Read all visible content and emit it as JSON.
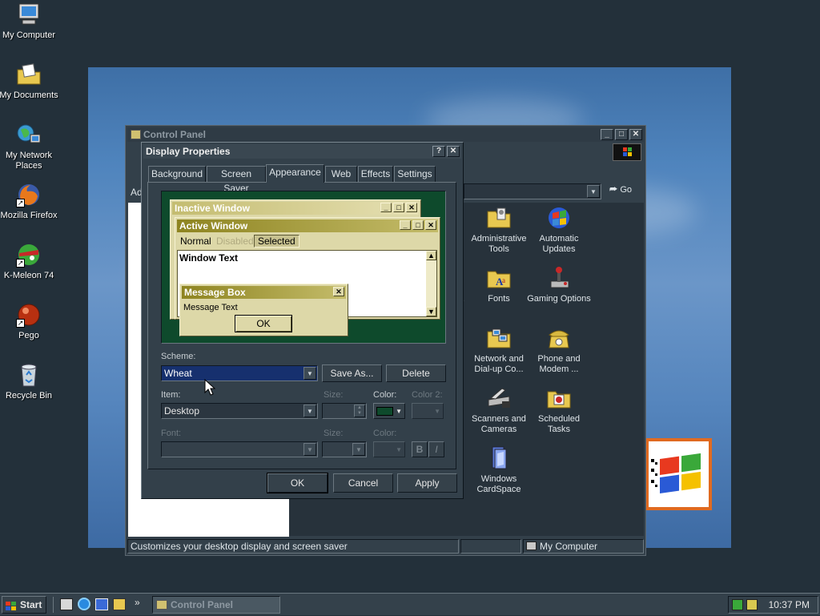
{
  "desktop": {
    "icons": [
      {
        "label": "My Computer",
        "icon": "computer-icon"
      },
      {
        "label": "My Documents",
        "icon": "folder-documents-icon"
      },
      {
        "label": "My Network Places",
        "icon": "network-icon"
      },
      {
        "label": "Mozilla Firefox",
        "icon": "firefox-icon"
      },
      {
        "label": "K-Meleon 74",
        "icon": "kmeleon-icon"
      },
      {
        "label": "Pego",
        "icon": "pego-icon"
      },
      {
        "label": "Recycle Bin",
        "icon": "recycle-bin-icon"
      }
    ]
  },
  "control_panel": {
    "title": "Control Panel",
    "address_label": "Ad",
    "go_label": "Go",
    "items": [
      {
        "label": "Administrative Tools",
        "icon": "administrative-tools-icon"
      },
      {
        "label": "Automatic Updates",
        "icon": "automatic-updates-icon"
      },
      {
        "label": "Fonts",
        "icon": "fonts-icon"
      },
      {
        "label": "Gaming Options",
        "icon": "gaming-options-icon"
      },
      {
        "label": "Network and Dial-up Co...",
        "icon": "network-dialup-icon"
      },
      {
        "label": "Phone and Modem ...",
        "icon": "phone-modem-icon"
      },
      {
        "label": "Scanners and Cameras",
        "icon": "scanners-cameras-icon"
      },
      {
        "label": "Scheduled Tasks",
        "icon": "scheduled-tasks-icon"
      },
      {
        "label": "Windows CardSpace",
        "icon": "cardspace-icon"
      }
    ],
    "status_text": "Customizes your desktop display and screen saver",
    "status_location": "My Computer"
  },
  "dialog": {
    "title": "Display Properties",
    "tabs": [
      "Background",
      "Screen Saver",
      "Appearance",
      "Web",
      "Effects",
      "Settings"
    ],
    "selected_tab": "Appearance",
    "preview": {
      "inactive_title": "Inactive Window",
      "active_title": "Active Window",
      "menu_normal": "Normal",
      "menu_disabled": "Disabled",
      "menu_selected": "Selected",
      "window_text": "Window Text",
      "message_box_title": "Message Box",
      "message_text": "Message Text",
      "ok_label": "OK"
    },
    "scheme_label": "Scheme:",
    "scheme_value": "Wheat",
    "save_as_label": "Save As...",
    "delete_label": "Delete",
    "item_label": "Item:",
    "item_value": "Desktop",
    "size_label": "Size:",
    "color_label": "Color:",
    "color2_label": "Color 2:",
    "font_label": "Font:",
    "font_size_label": "Size:",
    "font_color_label": "Color:",
    "bold_label": "B",
    "italic_label": "I",
    "ok_label": "OK",
    "cancel_label": "Cancel",
    "apply_label": "Apply",
    "desktop_color": "#0e4a2c"
  },
  "taskbar": {
    "start_label": "Start",
    "task_label": "Control Panel",
    "clock": "10:37 PM"
  }
}
